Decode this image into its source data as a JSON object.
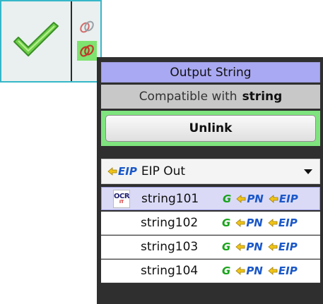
{
  "node": {
    "status_icon": "checkmark-icon",
    "link_icons": [
      "chain-link-icon",
      "chain-link-icon"
    ]
  },
  "panel": {
    "title": "Output String",
    "compatible_prefix": "Compatible with",
    "compatible_type": "string",
    "unlink_label": "Unlink",
    "select": {
      "badge": "EIP",
      "selected_value": "EIP Out"
    },
    "items": [
      {
        "name": "string101",
        "icon": "OCR",
        "icon_sub": "IT",
        "tag_g": "G",
        "tag_pn": "PN",
        "tag_eip": "EIP"
      },
      {
        "name": "string102",
        "tag_g": "G",
        "tag_pn": "PN",
        "tag_eip": "EIP"
      },
      {
        "name": "string103",
        "tag_g": "G",
        "tag_pn": "PN",
        "tag_eip": "EIP"
      },
      {
        "name": "string104",
        "tag_g": "G",
        "tag_pn": "PN",
        "tag_eip": "EIP"
      }
    ]
  },
  "colors": {
    "node_border": "#36b7c8",
    "title_bg": "#a9a8f2",
    "unlink_highlight": "#7fe47e",
    "selected_row": "#dadaf7",
    "tag_g": "#19a31b",
    "tag_blue": "#1a57c8",
    "arrow_yellow": "#f0c419"
  }
}
